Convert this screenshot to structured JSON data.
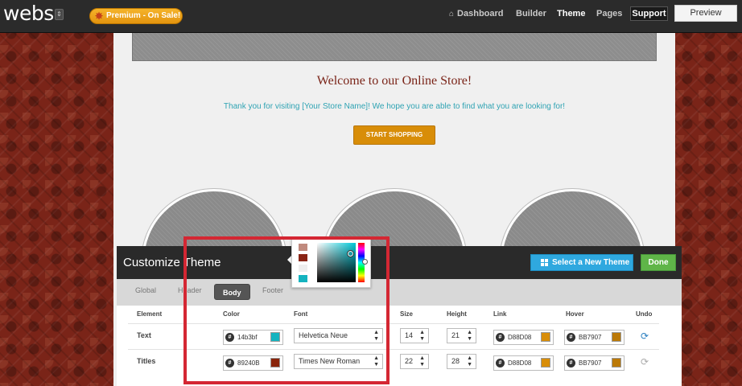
{
  "app": {
    "logo": "webs",
    "premium_label": "Premium - On Sale!"
  },
  "nav": {
    "dashboard": "Dashboard",
    "builder": "Builder",
    "theme": "Theme",
    "pages": "Pages",
    "support": "Support",
    "preview": "Preview"
  },
  "site": {
    "welcome": "Welcome to our Online Store!",
    "thanks": "Thank you for visiting [Your Store Name]!  We hope you are able to find what you are looking for!",
    "cta": "START SHOPPING"
  },
  "panel": {
    "title": "Customize Theme",
    "select_theme_label": "Select a New Theme",
    "done_label": "Done",
    "tabs": [
      "Global",
      "Header",
      "Body",
      "Footer"
    ],
    "active_tab": "Body",
    "columns": [
      "Element",
      "Color",
      "Font",
      "Size",
      "Height",
      "Link",
      "Hover",
      "Undo"
    ],
    "rows": [
      {
        "element": "Text",
        "color": "14b3bf",
        "font": "Helvetica Neue",
        "size": "14",
        "height": "21",
        "link": "D88D08",
        "hover": "BB7907"
      },
      {
        "element": "Titles",
        "color": "89240B",
        "font": "Times New Roman",
        "size": "22",
        "height": "28",
        "link": "D88D08",
        "hover": "BB7907"
      }
    ]
  },
  "picker": {
    "recent_colors": [
      "#c08a7e",
      "#8a2415",
      "#eeeeee",
      "#14b3bf"
    ]
  },
  "colors": {
    "accent_blue": "#2fa8df",
    "done_green": "#5fb548",
    "cta_orange": "#d88d08",
    "title_red": "#7a2418",
    "highlight": "#d42733"
  }
}
